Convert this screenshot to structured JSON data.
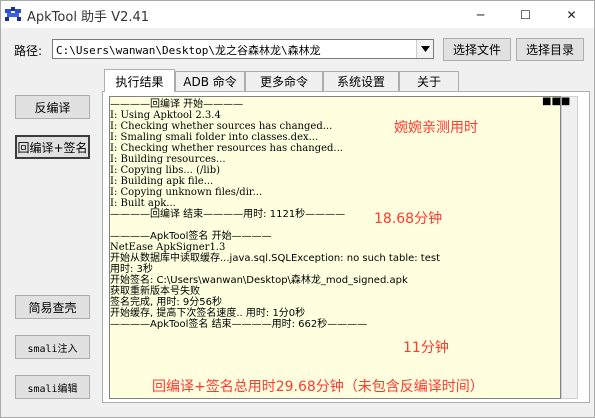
{
  "window": {
    "title": "ApkTool 助手 V2.41",
    "minimize": "─",
    "maximize": "☐",
    "close": "✕"
  },
  "path": {
    "label": "路径:",
    "value": "C:\\Users\\wanwan\\Desktop\\龙之谷森林龙\\森林龙",
    "select_file": "选择文件",
    "select_dir": "选择目录"
  },
  "tabs": [
    "执行结果",
    "ADB 命令",
    "更多命令",
    "系统设置",
    "关于"
  ],
  "left_buttons": {
    "decompile": "反编译",
    "recompile_sign": "回编译+签名",
    "shell_check": "简易查壳",
    "smali_inject": "smali注入",
    "smali_edit": "smali编辑"
  },
  "log": {
    "lines": [
      "————回编译 开始————",
      "I: Using Apktool 2.3.4",
      "I: Checking whether sources has changed...",
      "I: Smaling smali folder into classes.dex...",
      "I: Checking whether resources has changed...",
      "I: Building resources...",
      "I: Copying libs... (/lib)",
      "I: Building apk file...",
      "I: Copying unknown files/dir...",
      "I: Built apk...",
      "————回编译 结束————用时: 1121秒————",
      "",
      "————ApkTool签名 开始————",
      "NetEase ApkSigner1.3",
      "开始从数据库中读取缓存...java.sql.SQLException: no such table: test",
      "  用时: 3秒",
      "开始签名: C:\\Users\\wanwan\\Desktop\\森林龙_mod_signed.apk",
      "获取重新版本号失败",
      "签名完成, 用时: 9分56秒",
      "开始缓存, 提高下次签名速度.. 用时: 1分0秒",
      "————ApkTool签名 结束————用时: 662秒————"
    ],
    "menu_icon": "■■■"
  },
  "annotations": {
    "measured_by": "婉婉亲测用时",
    "decompile_time": "18.68分钟",
    "sign_time": "11分钟",
    "total": "回编译+签名总用时29.68分钟（未包含反编译时间）"
  },
  "colors": {
    "annotation": "#ff3b2f",
    "log_background": "#ffffe0"
  }
}
